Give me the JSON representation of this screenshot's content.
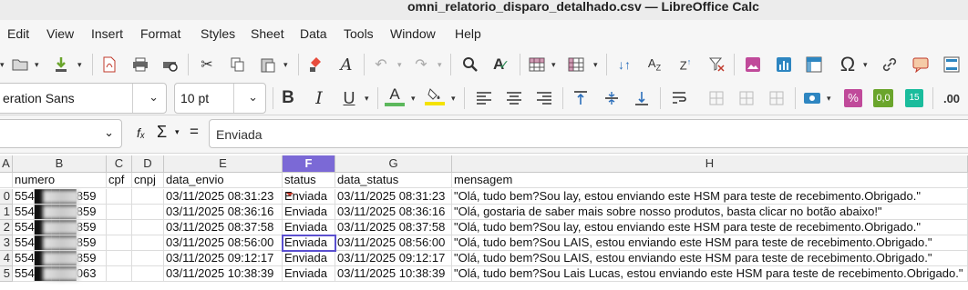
{
  "window": {
    "title": "omni_relatorio_disparo_detalhado.csv — LibreOffice Calc"
  },
  "menu": [
    "Edit",
    "View",
    "Insert",
    "Format",
    "Styles",
    "Sheet",
    "Data",
    "Tools",
    "Window",
    "Help"
  ],
  "font": {
    "name": "eration Sans",
    "size": "10 pt"
  },
  "formula": {
    "content": "Enviada",
    "fx": "fₓ",
    "sum": "Σ",
    "equals": "="
  },
  "columns": [
    {
      "id": "A",
      "selected": false
    },
    {
      "id": "B",
      "selected": false
    },
    {
      "id": "C",
      "selected": false
    },
    {
      "id": "D",
      "selected": false
    },
    {
      "id": "E",
      "selected": false
    },
    {
      "id": "F",
      "selected": true
    },
    {
      "id": "G",
      "selected": false
    },
    {
      "id": "H",
      "selected": false
    }
  ],
  "header_row": [
    "",
    "numero",
    "cpf",
    "cnpj",
    "data_envio",
    "status",
    "data_status",
    "mensagem"
  ],
  "rows": [
    {
      "idx": "0",
      "a": "",
      "numero": "554█████859",
      "cpf": "",
      "cnpj": "",
      "data_envio": "03/11/2025 08:31:23",
      "status": "Enviada",
      "data_status": "03/11/2025 08:31:23",
      "mensagem": "\"Olá, tudo bem?Sou lay, estou enviando este HSM para teste de recebimento.Obrigado.\""
    },
    {
      "idx": "1",
      "a": "",
      "numero": "554█████859",
      "cpf": "",
      "cnpj": "",
      "data_envio": "03/11/2025 08:36:16",
      "status": "Enviada",
      "data_status": "03/11/2025 08:36:16",
      "mensagem": "\"Olá, gostaria de saber mais sobre nosso produtos, basta clicar no botão abaixo!\""
    },
    {
      "idx": "2",
      "a": "",
      "numero": "554█████859",
      "cpf": "",
      "cnpj": "",
      "data_envio": "03/11/2025 08:37:58",
      "status": "Enviada",
      "data_status": "03/11/2025 08:37:58",
      "mensagem": "\"Olá, tudo bem?Sou lay, estou enviando este HSM para teste de recebimento.Obrigado.\""
    },
    {
      "idx": "3",
      "a": "",
      "numero": "554█████859",
      "cpf": "",
      "cnpj": "",
      "data_envio": "03/11/2025 08:56:00",
      "status": "Enviada",
      "data_status": "03/11/2025 08:56:00",
      "mensagem": "\"Olá, tudo bem?Sou LAIS, estou enviando este HSM para teste de recebimento.Obrigado.\""
    },
    {
      "idx": "4",
      "a": "",
      "numero": "554█████859",
      "cpf": "",
      "cnpj": "",
      "data_envio": "03/11/2025 09:12:17",
      "status": "Enviada",
      "data_status": "03/11/2025 09:12:17",
      "mensagem": "\"Olá, tudo bem?Sou LAIS, estou enviando este HSM para teste de recebimento.Obrigado.\""
    },
    {
      "idx": "5",
      "a": "",
      "numero": "554█████063",
      "cpf": "",
      "cnpj": "",
      "data_envio": "03/11/2025 10:38:39",
      "status": "Enviada",
      "data_status": "03/11/2025 10:38:39",
      "mensagem": "\"Olá, tudo bem?Sou Lais Lucas, estou enviando este HSM para teste de recebimento.Obrigado.\""
    }
  ],
  "colors": {
    "selected_header": "#7b69d6",
    "active_cell_border": "#5a4fcf"
  }
}
